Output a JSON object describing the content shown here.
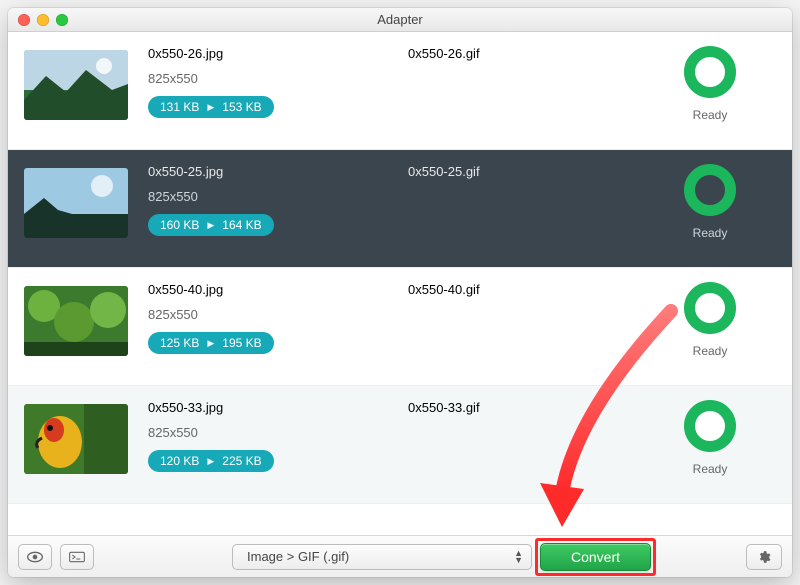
{
  "window": {
    "title": "Adapter"
  },
  "rows": [
    {
      "src_name": "0x550-26.jpg",
      "dst_name": "0x550-26.gif",
      "dimensions": "825x550",
      "src_size": "131 KB",
      "dst_size": "153 KB",
      "status": "Ready",
      "thumb": "landscape1"
    },
    {
      "src_name": "0x550-25.jpg",
      "dst_name": "0x550-25.gif",
      "dimensions": "825x550",
      "src_size": "160 KB",
      "dst_size": "164 KB",
      "status": "Ready",
      "thumb": "beach"
    },
    {
      "src_name": "0x550-40.jpg",
      "dst_name": "0x550-40.gif",
      "dimensions": "825x550",
      "src_size": "125 KB",
      "dst_size": "195 KB",
      "status": "Ready",
      "thumb": "foliage"
    },
    {
      "src_name": "0x550-33.jpg",
      "dst_name": "0x550-33.gif",
      "dimensions": "825x550",
      "src_size": "120 KB",
      "dst_size": "225 KB",
      "status": "Ready",
      "thumb": "parrot"
    }
  ],
  "toolbar": {
    "format_label": "Image > GIF (.gif)",
    "convert_label": "Convert",
    "preview_icon": "eye-icon",
    "console_icon": "terminal-icon",
    "settings_icon": "gear-icon"
  },
  "colors": {
    "accent_pill": "#18a9b8",
    "accent_ring": "#1cb65d",
    "convert_button": "#2db853",
    "highlight": "#ff2a2a"
  }
}
